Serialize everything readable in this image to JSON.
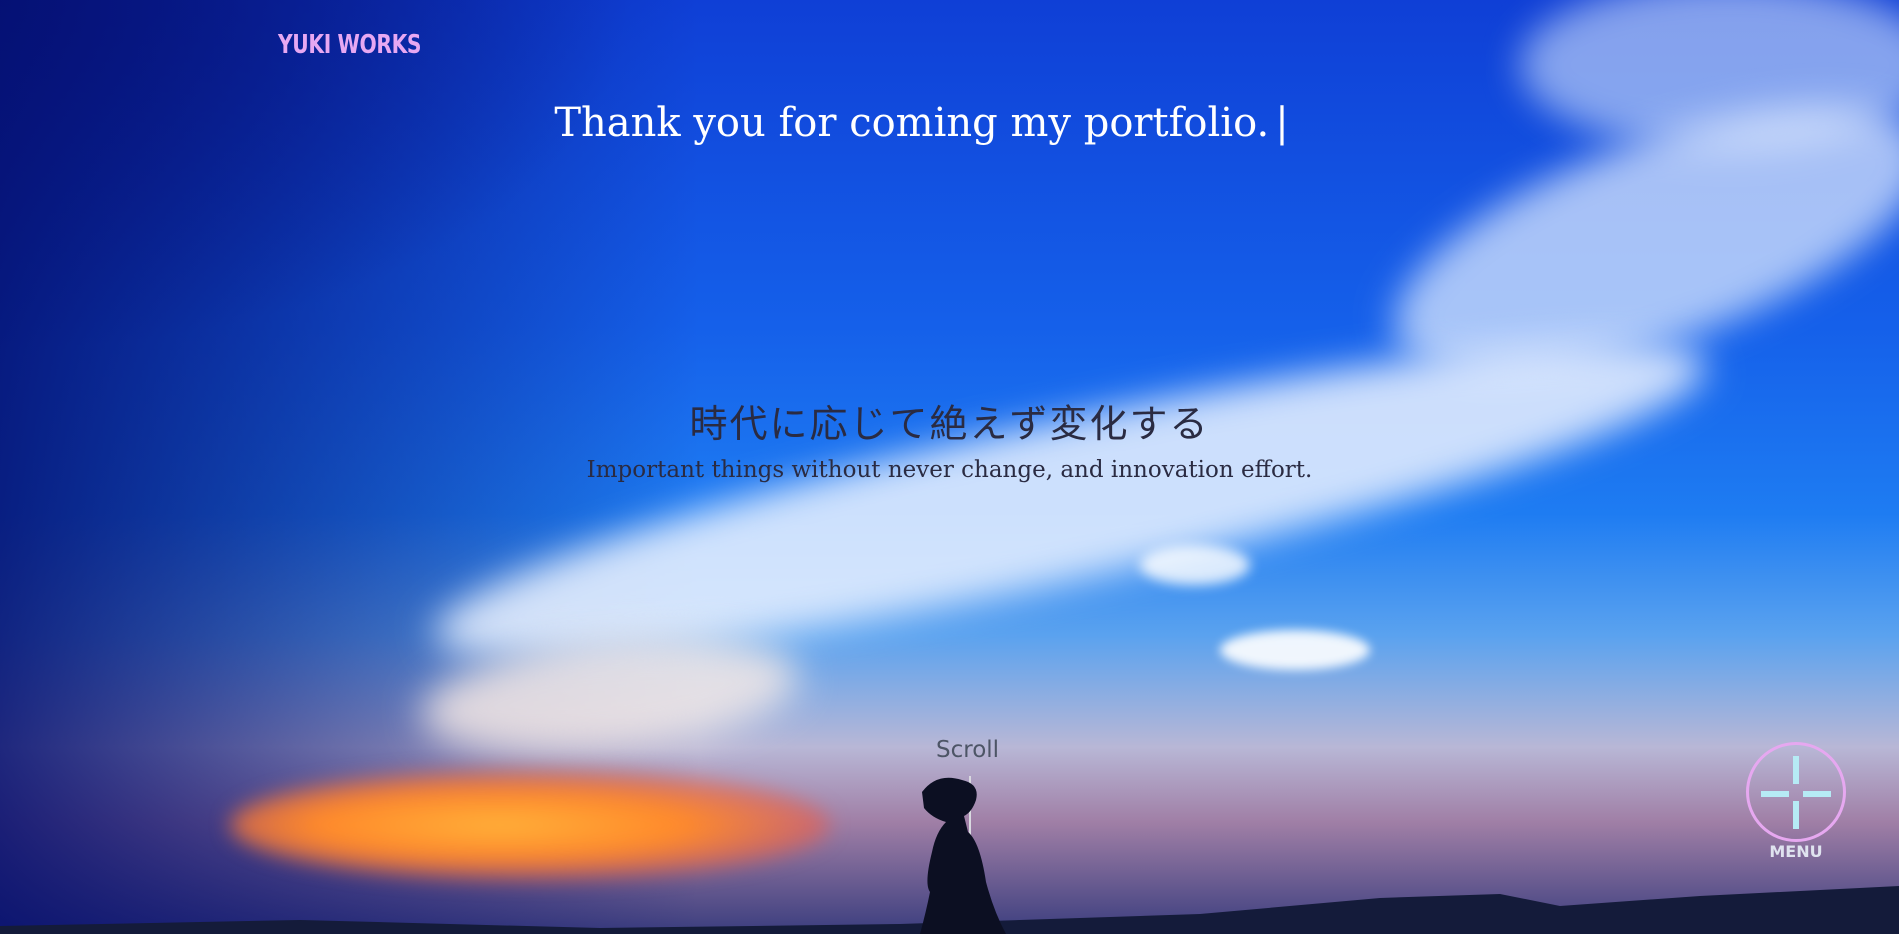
{
  "header": {
    "logo_text": "YUKI WORKS"
  },
  "hero": {
    "headline": "Thank you for coming my portfolio.",
    "headline_cursor": "|",
    "jp_title": "時代に応じて絶えず変化する",
    "en_subtitle": "Important things without never change, and innovation effort.",
    "scroll_label": "Scroll"
  },
  "menu": {
    "label": "MENU"
  },
  "colors": {
    "logo": "#e7a8f2",
    "menu_ring": "#e6a8f0",
    "menu_cross": "#b6ebf5",
    "sky_blue": "#1560ea",
    "heading_text": "#ffffff",
    "tagline_text": "#2a2b42"
  },
  "icons": {
    "menu": "plus-cross-icon"
  }
}
